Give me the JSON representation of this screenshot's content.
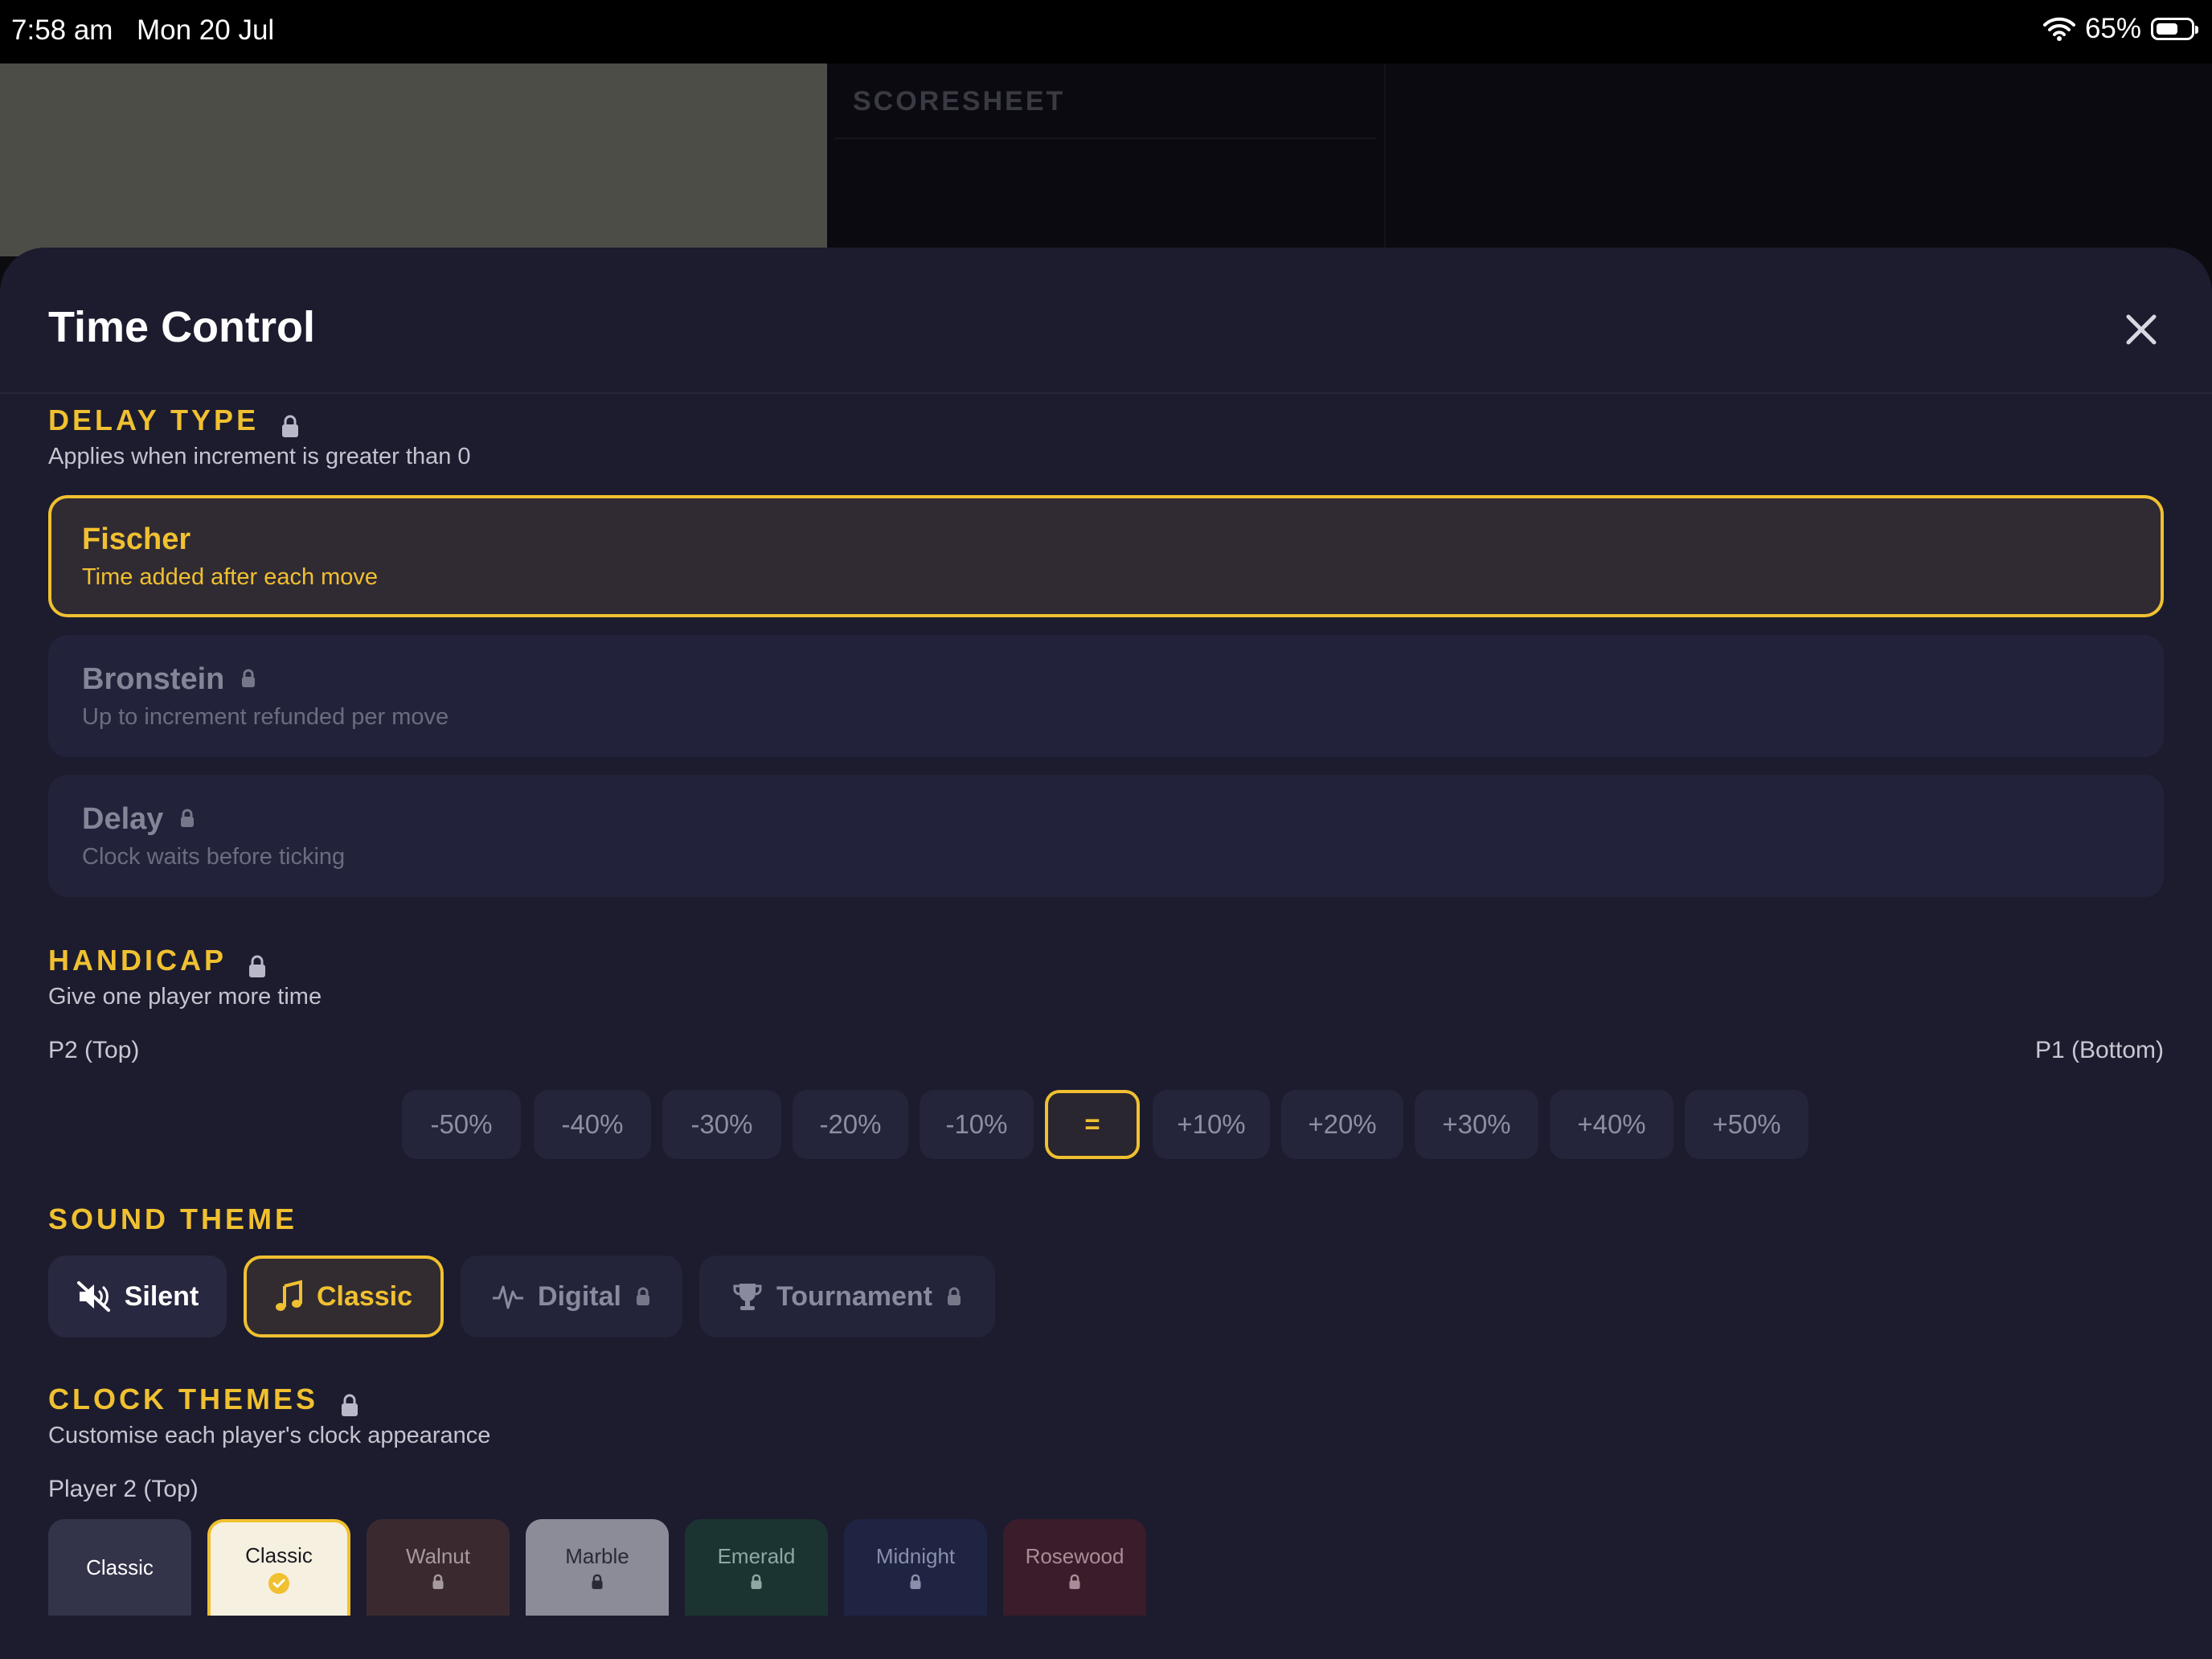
{
  "status_bar": {
    "time": "7:58 am",
    "date": "Mon 20 Jul",
    "battery_percent": "65%",
    "battery_level": 0.65,
    "icons": [
      "wifi-icon",
      "battery-icon"
    ]
  },
  "background": {
    "scoresheet_title": "SCORESHEET"
  },
  "sheet": {
    "title": "Time Control",
    "close_icon": "close-icon"
  },
  "delay_type": {
    "title": "DELAY TYPE",
    "subtitle": "Applies when increment is greater than 0",
    "locked": true,
    "options": [
      {
        "name": "Fischer",
        "description": "Time added after each move",
        "selected": true,
        "locked": false
      },
      {
        "name": "Bronstein",
        "description": "Up to increment refunded per move",
        "selected": false,
        "locked": true
      },
      {
        "name": "Delay",
        "description": "Clock waits before ticking",
        "selected": false,
        "locked": true
      }
    ]
  },
  "handicap": {
    "title": "HANDICAP",
    "subtitle": "Give one player more time",
    "locked": true,
    "left_label": "P2 (Top)",
    "right_label": "P1 (Bottom)",
    "options": [
      "-50%",
      "-40%",
      "-30%",
      "-20%",
      "-10%",
      "=",
      "+10%",
      "+20%",
      "+30%",
      "+40%",
      "+50%"
    ],
    "selected": "="
  },
  "sound_theme": {
    "title": "SOUND THEME",
    "options": [
      {
        "label": "Silent",
        "icon": "speaker-muted-icon",
        "selected": false,
        "locked": false
      },
      {
        "label": "Classic",
        "icon": "music-note-icon",
        "selected": true,
        "locked": false
      },
      {
        "label": "Digital",
        "icon": "waveform-icon",
        "selected": false,
        "locked": true
      },
      {
        "label": "Tournament",
        "icon": "trophy-icon",
        "selected": false,
        "locked": true
      }
    ]
  },
  "clock_themes": {
    "title": "CLOCK THEMES",
    "subtitle": "Customise each player's clock appearance",
    "locked": true,
    "player_label": "Player 2 (Top)",
    "themes": [
      {
        "name": "Classic",
        "bg": "#33334a",
        "fg": "#ffffff",
        "selected": false,
        "locked": false
      },
      {
        "name": "Classic",
        "bg": "#f6f0e0",
        "fg": "#1a1a22",
        "selected": true,
        "locked": false
      },
      {
        "name": "Walnut",
        "bg": "#3a2a30",
        "fg": "#a69aa0",
        "selected": false,
        "locked": true
      },
      {
        "name": "Marble",
        "bg": "#8c8c98",
        "fg": "#2a2a34",
        "selected": false,
        "locked": true
      },
      {
        "name": "Emerald",
        "bg": "#1b3432",
        "fg": "#90a8a4",
        "selected": false,
        "locked": true
      },
      {
        "name": "Midnight",
        "bg": "#1e2442",
        "fg": "#8a90aa",
        "selected": false,
        "locked": true
      },
      {
        "name": "Rosewood",
        "bg": "#3a1c2a",
        "fg": "#aa8c98",
        "selected": false,
        "locked": true
      }
    ]
  },
  "colors": {
    "accent": "#f0c030",
    "sheet_bg": "#1c1c2e",
    "card_bg": "#22223a"
  }
}
